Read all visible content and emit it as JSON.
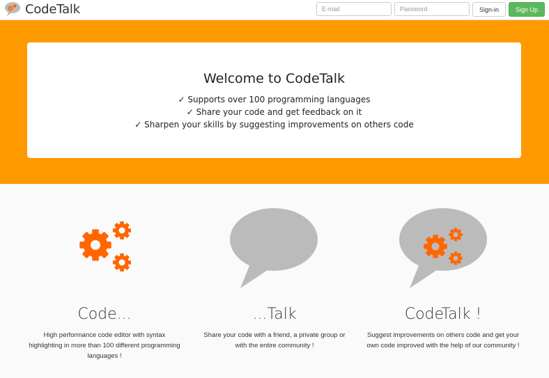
{
  "navbar": {
    "brand": "CodeTalk",
    "email_placeholder": "E-mail",
    "password_placeholder": "Password",
    "signin_label": "Sign-in",
    "signup_label": "Sign Up"
  },
  "hero": {
    "title": "Welcome to CodeTalk",
    "features": [
      "✓ Supports over 100 programming languages",
      "✓ Share your code and get feedback on it",
      "✓ Sharpen your skills by suggesting improvements on others code"
    ]
  },
  "columns": [
    {
      "icon": "gears-icon",
      "title": "Code...",
      "description": "High performance code editor with syntax highlighting in more than 100 different programming languages !"
    },
    {
      "icon": "speech-bubble-icon",
      "title": "...Talk",
      "description": "Share your code with a friend, a private group or with the entire community !"
    },
    {
      "icon": "speech-bubble-gears-icon",
      "title": "CodeTalk !",
      "description": "Suggest improvements on others code and get your own code improved with the help of our community !"
    }
  ],
  "colors": {
    "orange": "#ff9900",
    "gear": "#ff6600",
    "bubble": "#bbbbbb",
    "success": "#5cb85c"
  }
}
